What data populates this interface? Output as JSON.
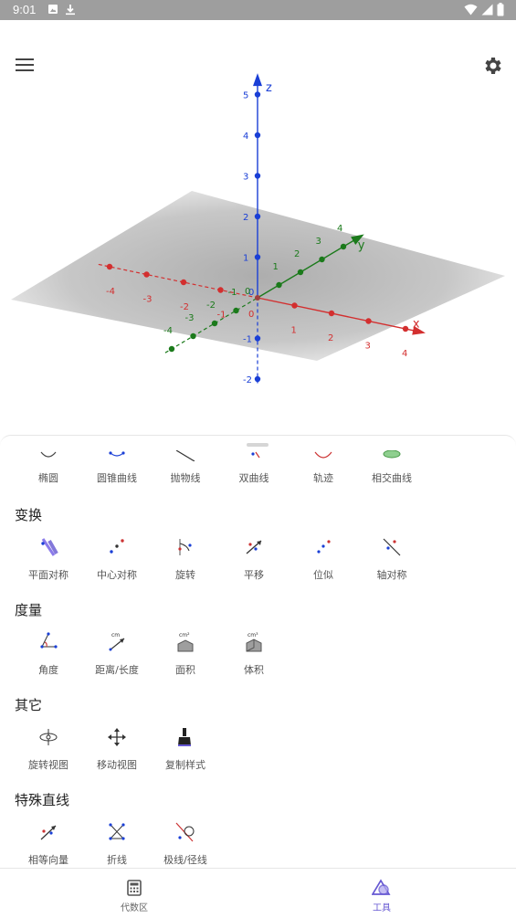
{
  "status_bar": {
    "time": "9:01"
  },
  "graphics_view": {
    "axes": {
      "x": {
        "label": "x",
        "color": "#d32f2f",
        "ticks": [
          "-4",
          "-3",
          "-2",
          "-1",
          "0",
          "1",
          "2",
          "3",
          "4"
        ]
      },
      "y": {
        "label": "y",
        "color": "#1b7a1b",
        "ticks": [
          "-4",
          "-3",
          "-2",
          "-1",
          "0",
          "1",
          "2",
          "3",
          "4"
        ]
      },
      "z": {
        "label": "z",
        "color": "#1a3fd6",
        "ticks": [
          "-2",
          "-1",
          "0",
          "1",
          "2",
          "3",
          "4",
          "5"
        ]
      }
    }
  },
  "tools_panel": {
    "partial_row": [
      {
        "label": "椭圆",
        "icon": "ellipse-icon"
      },
      {
        "label": "圆锥曲线",
        "icon": "conic-icon"
      },
      {
        "label": "抛物线",
        "icon": "parabola-icon"
      },
      {
        "label": "双曲线",
        "icon": "hyperbola-icon"
      },
      {
        "label": "轨迹",
        "icon": "locus-icon"
      },
      {
        "label": "相交曲线",
        "icon": "intersection-curve-icon"
      }
    ],
    "sections": [
      {
        "title": "变换",
        "tools": [
          {
            "label": "平面对称",
            "icon": "reflect-plane-icon"
          },
          {
            "label": "中心对称",
            "icon": "reflect-point-icon"
          },
          {
            "label": "旋转",
            "icon": "rotate-icon"
          },
          {
            "label": "平移",
            "icon": "translate-icon"
          },
          {
            "label": "位似",
            "icon": "dilate-icon"
          },
          {
            "label": "轴对称",
            "icon": "reflect-line-icon"
          }
        ]
      },
      {
        "title": "度量",
        "tools": [
          {
            "label": "角度",
            "icon": "angle-icon"
          },
          {
            "label": "距离/长度",
            "icon": "distance-icon"
          },
          {
            "label": "面积",
            "icon": "area-icon"
          },
          {
            "label": "体积",
            "icon": "volume-icon"
          }
        ]
      },
      {
        "title": "其它",
        "tools": [
          {
            "label": "旋转视图",
            "icon": "rotate-view-icon"
          },
          {
            "label": "移动视图",
            "icon": "move-view-icon"
          },
          {
            "label": "复制样式",
            "icon": "copy-style-icon"
          }
        ]
      },
      {
        "title": "特殊直线",
        "tools": [
          {
            "label": "相等向量",
            "icon": "vector-from-point-icon"
          },
          {
            "label": "折线",
            "icon": "polyline-icon"
          },
          {
            "label": "极线/径线",
            "icon": "polar-line-icon"
          }
        ]
      }
    ]
  },
  "bottom_nav": {
    "algebra_label": "代数区",
    "tools_label": "工具",
    "active_color": "#6557d2",
    "inactive_color": "#666666"
  }
}
